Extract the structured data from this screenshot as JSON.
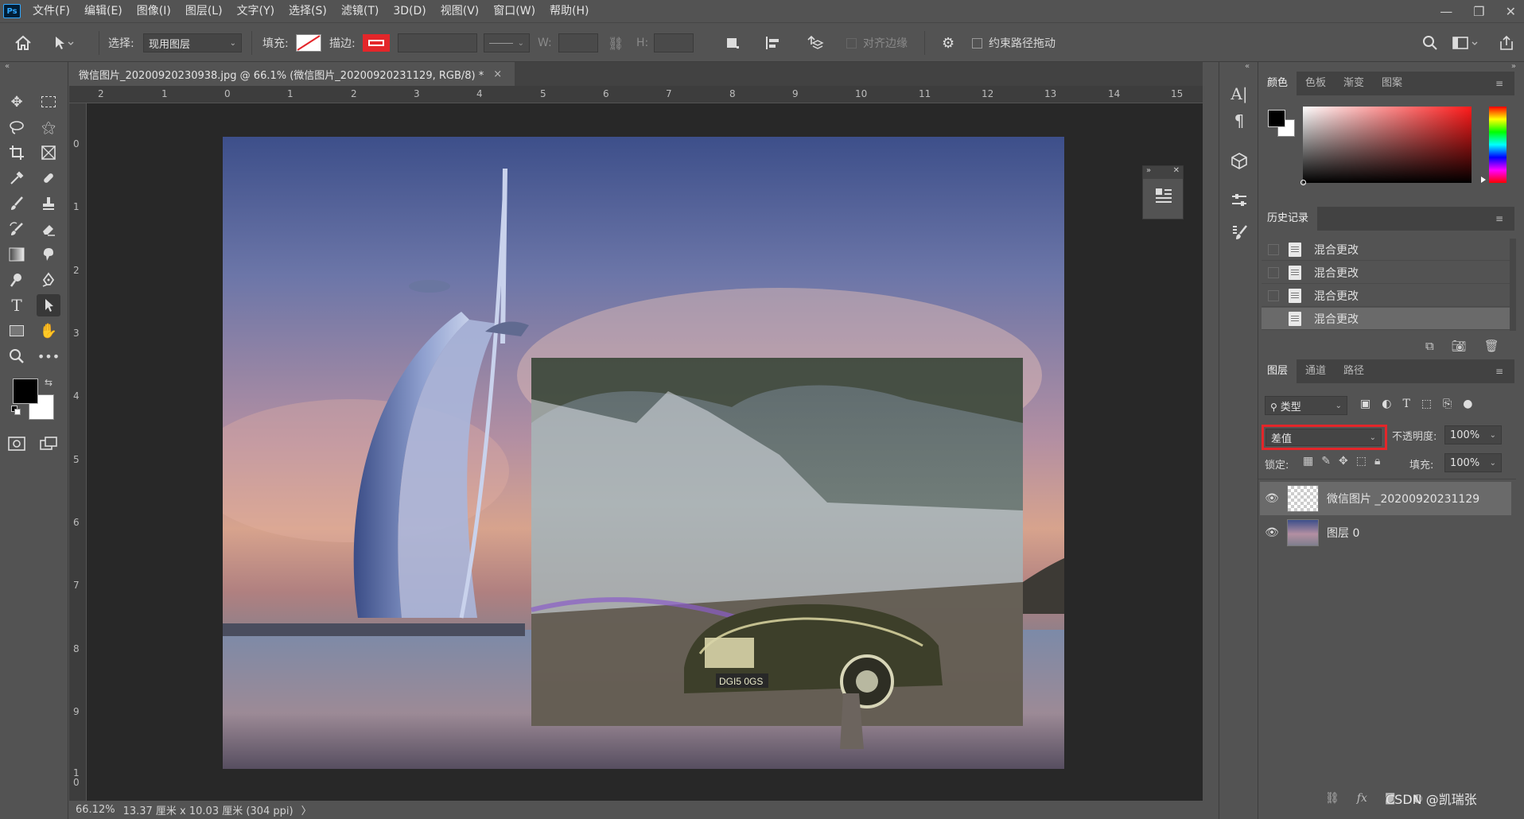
{
  "app": {
    "logo": "Ps"
  },
  "menu": [
    "文件(F)",
    "编辑(E)",
    "图像(I)",
    "图层(L)",
    "文字(Y)",
    "选择(S)",
    "滤镜(T)",
    "3D(D)",
    "视图(V)",
    "窗口(W)",
    "帮助(H)"
  ],
  "window_controls": {
    "minimize": "—",
    "restore": "❐",
    "close": "✕"
  },
  "options": {
    "select_label": "选择:",
    "select_value": "现用图层",
    "fill_label": "填充:",
    "stroke_label": "描边:",
    "w_label": "W:",
    "h_label": "H:",
    "align_edges": "对齐边缘",
    "constrain_path": "约束路径拖动"
  },
  "document": {
    "tab_title": "微信图片_20200920230938.jpg @ 66.1% (微信图片_20200920231129, RGB/8) *",
    "close": "×",
    "ruler_h": [
      "2",
      "1",
      "0",
      "1",
      "2",
      "3",
      "4",
      "5",
      "6",
      "7",
      "8",
      "9",
      "10",
      "11",
      "12",
      "13",
      "14",
      "15"
    ],
    "ruler_v": [
      "0",
      "1",
      "2",
      "3",
      "4",
      "5",
      "6",
      "7",
      "8",
      "9",
      "1\n0"
    ],
    "plate_text": "DGI5 0GS"
  },
  "status": {
    "zoom": "66.12%",
    "dims": "13.37 厘米 x 10.03 厘米 (304 ppi)",
    "arrow": "〉"
  },
  "panels": {
    "color_tabs": [
      "颜色",
      "色板",
      "渐变",
      "图案"
    ],
    "history_tab": "历史记录",
    "history_items": [
      "混合更改",
      "混合更改",
      "混合更改",
      "混合更改"
    ],
    "layers_tabs": [
      "图层",
      "通道",
      "路径"
    ],
    "filter_kind": "类型",
    "blend_mode": "差值",
    "opacity_label": "不透明度:",
    "opacity_value": "100%",
    "lock_label": "锁定:",
    "fill_label": "填充:",
    "fill_value": "100%",
    "layers": [
      {
        "name": "微信图片 _20200920231129"
      },
      {
        "name": "图层 0"
      }
    ]
  },
  "watermark": "CSDN @凯瑞张",
  "colors": {
    "accent_red": "#e3262a",
    "fg": "#000000",
    "bg": "#ffffff"
  }
}
